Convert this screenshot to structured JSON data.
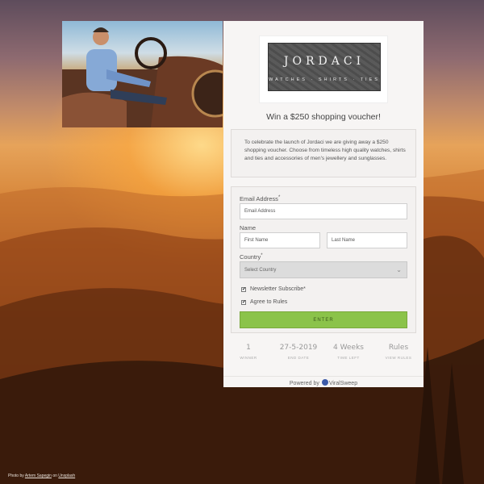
{
  "photo_credit": {
    "prefix": "Photo by",
    "author": "Artem Sapegin",
    "mid": "on",
    "site": "Unsplash"
  },
  "logo": {
    "name": "JORDACI",
    "tagline": "WATCHES · SHIRTS · TIES"
  },
  "headline": "Win a $250 shopping voucher!",
  "description": "To celebrate the launch of Jordaci we are giving away a $250 shopping voucher.  Choose from timeless high quality watches, shirts and ties and accessories of men's jewellery and sunglasses.",
  "form": {
    "email_label": "Email Address",
    "email_placeholder": "Email Address",
    "name_label": "Name",
    "first_placeholder": "First Name",
    "last_placeholder": "Last Name",
    "country_label": "Country",
    "country_value": "Select Country",
    "newsletter_label": "Newsletter Subscribe",
    "rules_label": "Agree to Rules",
    "required_mark": "*",
    "enter_label": "ENTER"
  },
  "stats": [
    {
      "value": "1",
      "key": "WINNER"
    },
    {
      "value": "27-5-2019",
      "key": "END DATE"
    },
    {
      "value": "4 Weeks",
      "key": "TIME LEFT"
    },
    {
      "value": "Rules",
      "key": "VIEW RULES"
    }
  ],
  "powered": {
    "prefix": "Powered by",
    "brand": "ViralSweep"
  }
}
